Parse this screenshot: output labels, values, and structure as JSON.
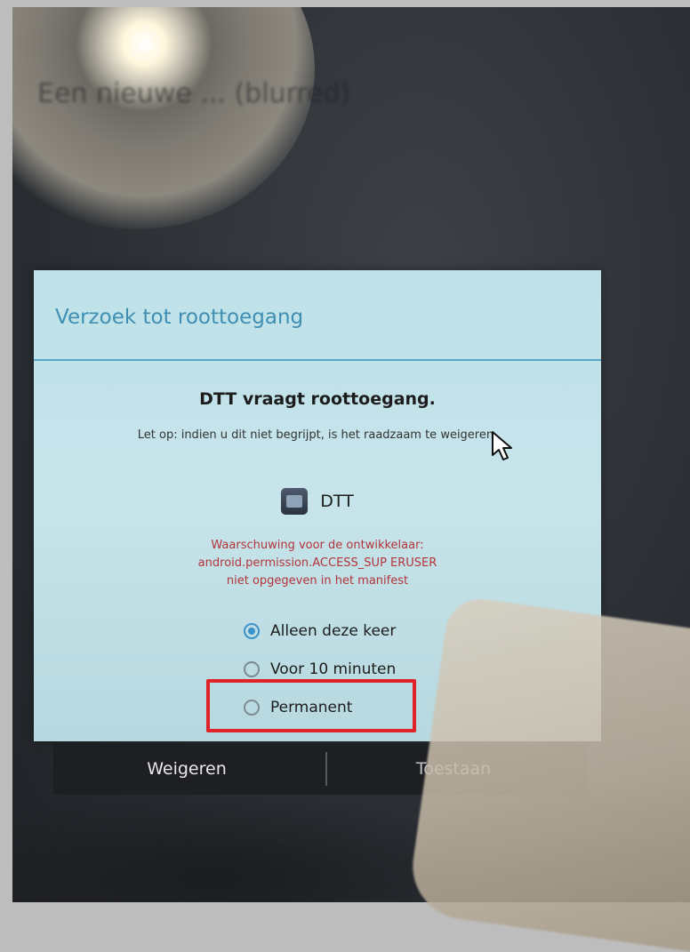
{
  "background_text": "Een nieuwe ... (blurred)",
  "dialog": {
    "title": "Verzoek tot roottoegang",
    "headline": "DTT vraagt roottoegang.",
    "subtitle": "Let op: indien u dit niet begrijpt, is het raadzaam te weigeren.",
    "app": {
      "name": "DTT",
      "icon": "app-icon"
    },
    "warning": {
      "line1": "Waarschuwing voor de ontwikkelaar:",
      "line2": "android.permission.ACCESS_SUP ERUSER",
      "line3": "niet opgegeven in het manifest"
    },
    "options": [
      {
        "label": "Alleen deze keer",
        "checked": true
      },
      {
        "label": "Voor 10 minuten",
        "checked": false
      },
      {
        "label": "Permanent",
        "checked": false
      }
    ],
    "buttons": {
      "deny": "Weigeren",
      "allow": "Toestaan"
    }
  },
  "colors": {
    "title_blue": "#3f8fb3",
    "warning_red": "#b4343a",
    "highlight_red": "#e0222a",
    "radio_blue": "#3a92c9"
  }
}
